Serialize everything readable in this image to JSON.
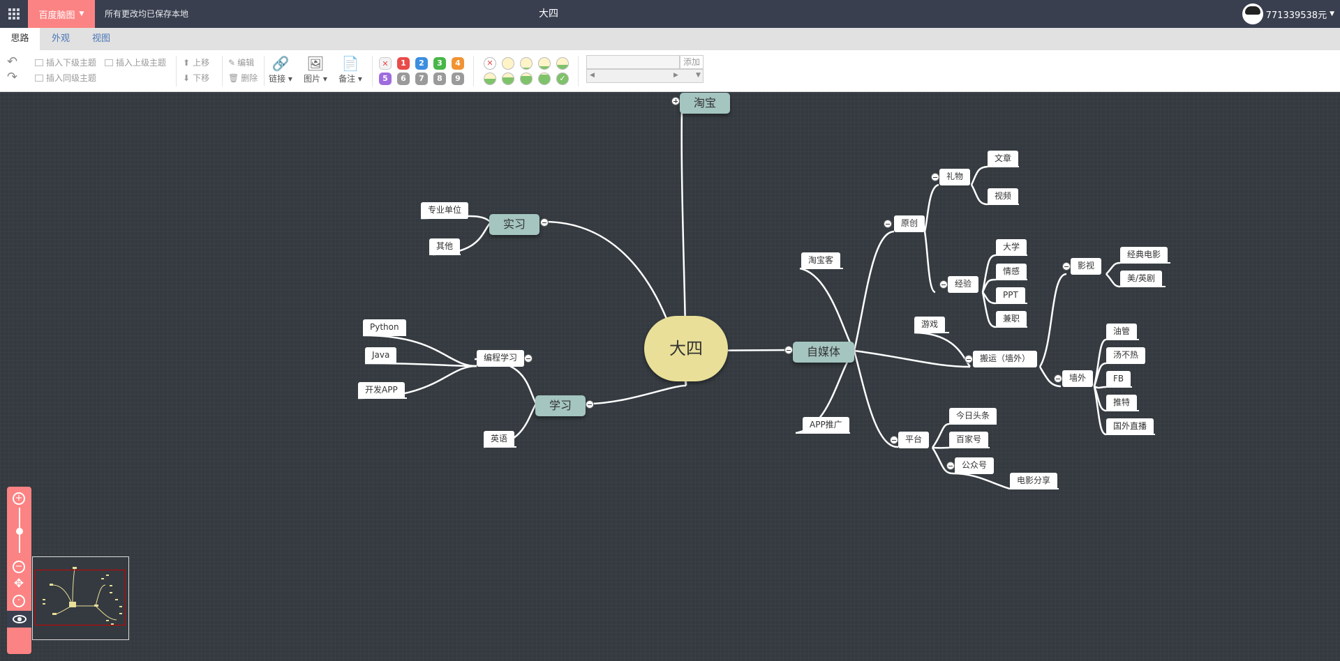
{
  "topbar": {
    "brand": "百度脑图",
    "save_status": "所有更改均已保存本地",
    "doc_title": "大四",
    "user_name": "771339538元"
  },
  "tabs": [
    {
      "label": "思路",
      "active": true
    },
    {
      "label": "外观",
      "active": false
    },
    {
      "label": "视图",
      "active": false
    }
  ],
  "toolbar": {
    "insert_child": "插入下级主题",
    "insert_parent": "插入上级主题",
    "insert_sibling": "插入同级主题",
    "move_up": "上移",
    "move_down": "下移",
    "edit": "编辑",
    "delete": "删除",
    "link": "链接",
    "image": "图片",
    "note": "备注",
    "priorities": [
      "1",
      "2",
      "3",
      "4",
      "5",
      "6",
      "7",
      "8",
      "9"
    ],
    "priority_colors": [
      "#e94b4b",
      "#3c8ee0",
      "#48b648",
      "#f19332",
      "#9f6cdf",
      "#9a9a9a",
      "#9a9a9a",
      "#9a9a9a",
      "#9a9a9a"
    ],
    "progress_levels": [
      0,
      0.125,
      0.25,
      0.375,
      0.5,
      0.625,
      0.75,
      0.875,
      1
    ],
    "resource_add": "添加"
  },
  "mindmap": {
    "root": "大四",
    "taobao": "淘宝",
    "shixi": "实习",
    "zhuanye": "专业单位",
    "qita": "其他",
    "xuexi": "学习",
    "biancheng": "编程学习",
    "python": "Python",
    "java": "Java",
    "kaifa": "开发APP",
    "yingyu": "英语",
    "zimeiti": "自媒体",
    "taobaoke": "淘宝客",
    "appt": "APP推广",
    "yuanchuang": "原创",
    "liwu": "礼物",
    "wenzhang": "文章",
    "shipin": "视频",
    "jingyan": "经验",
    "daxue": "大学",
    "qinggan": "情感",
    "ppt": "PPT",
    "jianzhi": "兼职",
    "youxi": "游戏",
    "banyun": "搬运（墙外）",
    "yingshi": "影视",
    "jingdian": "经典电影",
    "meiying": "美/英剧",
    "qiangwai": "墙外",
    "youguan": "油管",
    "tangbure": "汤不热",
    "fb": "FB",
    "tuite": "推特",
    "guowai": "国外直播",
    "pingtai": "平台",
    "jinri": "今日头条",
    "baijia": "百家号",
    "gongzhong": "公众号",
    "dianying": "电影分享"
  }
}
